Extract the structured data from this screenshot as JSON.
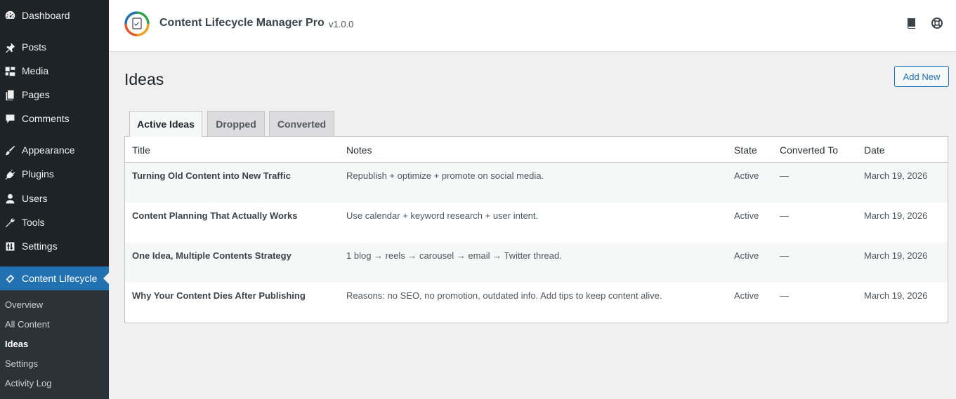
{
  "sidebar": {
    "items": [
      {
        "label": "Dashboard",
        "icon": "dashboard-icon"
      },
      {
        "label": "Posts",
        "icon": "pin-icon"
      },
      {
        "label": "Media",
        "icon": "media-icon"
      },
      {
        "label": "Pages",
        "icon": "pages-icon"
      },
      {
        "label": "Comments",
        "icon": "comment-icon"
      },
      {
        "label": "Appearance",
        "icon": "brush-icon"
      },
      {
        "label": "Plugins",
        "icon": "plug-icon"
      },
      {
        "label": "Users",
        "icon": "user-icon"
      },
      {
        "label": "Tools",
        "icon": "wrench-icon"
      },
      {
        "label": "Settings",
        "icon": "settings-icon"
      },
      {
        "label": "Content Lifecycle",
        "icon": "content-lifecycle-icon"
      }
    ],
    "submenu": [
      "Overview",
      "All Content",
      "Ideas",
      "Settings",
      "Activity Log"
    ],
    "current_submenu": "Ideas"
  },
  "header": {
    "title": "Content Lifecycle Manager Pro",
    "version": "v1.0.0"
  },
  "page": {
    "title": "Ideas",
    "add_new_label": "Add New"
  },
  "tabs": [
    {
      "label": "Active Ideas",
      "active": true
    },
    {
      "label": "Dropped",
      "active": false
    },
    {
      "label": "Converted",
      "active": false
    }
  ],
  "table": {
    "columns": [
      "Title",
      "Notes",
      "State",
      "Converted To",
      "Date"
    ],
    "rows": [
      {
        "title": "Turning Old Content into New Traffic",
        "notes": "Republish + optimize + promote on social media.",
        "state": "Active",
        "converted_to": "—",
        "date": "March 19, 2026"
      },
      {
        "title": "Content Planning That Actually Works",
        "notes": "Use calendar + keyword research + user intent.",
        "state": "Active",
        "converted_to": "—",
        "date": "March 19, 2026"
      },
      {
        "title": "One Idea, Multiple Contents Strategy",
        "notes": "1 blog → reels → carousel → email → Twitter thread.",
        "state": "Active",
        "converted_to": "—",
        "date": "March 19, 2026"
      },
      {
        "title": "Why Your Content Dies After Publishing",
        "notes": "Reasons: no SEO, no promotion, outdated info. Add tips to keep content alive.",
        "state": "Active",
        "converted_to": "—",
        "date": "March 19, 2026"
      }
    ]
  },
  "colors": {
    "accent": "#2271b1",
    "sidebar_bg": "#1d2327",
    "submenu_bg": "#2c3338"
  }
}
